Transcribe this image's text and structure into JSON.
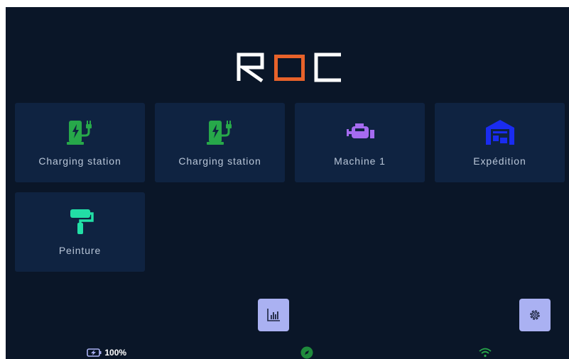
{
  "app": {
    "logo_text": "ROC"
  },
  "tiles": [
    {
      "label": "Charging station",
      "icon": "charging-station-icon",
      "color": "#27a84a"
    },
    {
      "label": "Charging station",
      "icon": "charging-station-icon",
      "color": "#27a84a"
    },
    {
      "label": "Machine 1",
      "icon": "engine-icon",
      "color": "#a56bf0"
    },
    {
      "label": "Expédition",
      "icon": "warehouse-icon",
      "color": "#1a2cf0"
    },
    {
      "label": "Peinture",
      "icon": "paint-roller-icon",
      "color": "#22dfa6"
    }
  ],
  "toolbar": {
    "stats_icon": "bar-chart-icon",
    "settings_icon": "gear-icon"
  },
  "status_bar": {
    "battery_level": "100%",
    "battery_icon": "battery-charging-icon",
    "compass_icon": "compass-icon",
    "wifi_icon": "wifi-icon"
  },
  "colors": {
    "background": "#0a1628",
    "tile": "#0f2341",
    "accent_orange": "#e8622a",
    "button": "#aab1f2"
  }
}
